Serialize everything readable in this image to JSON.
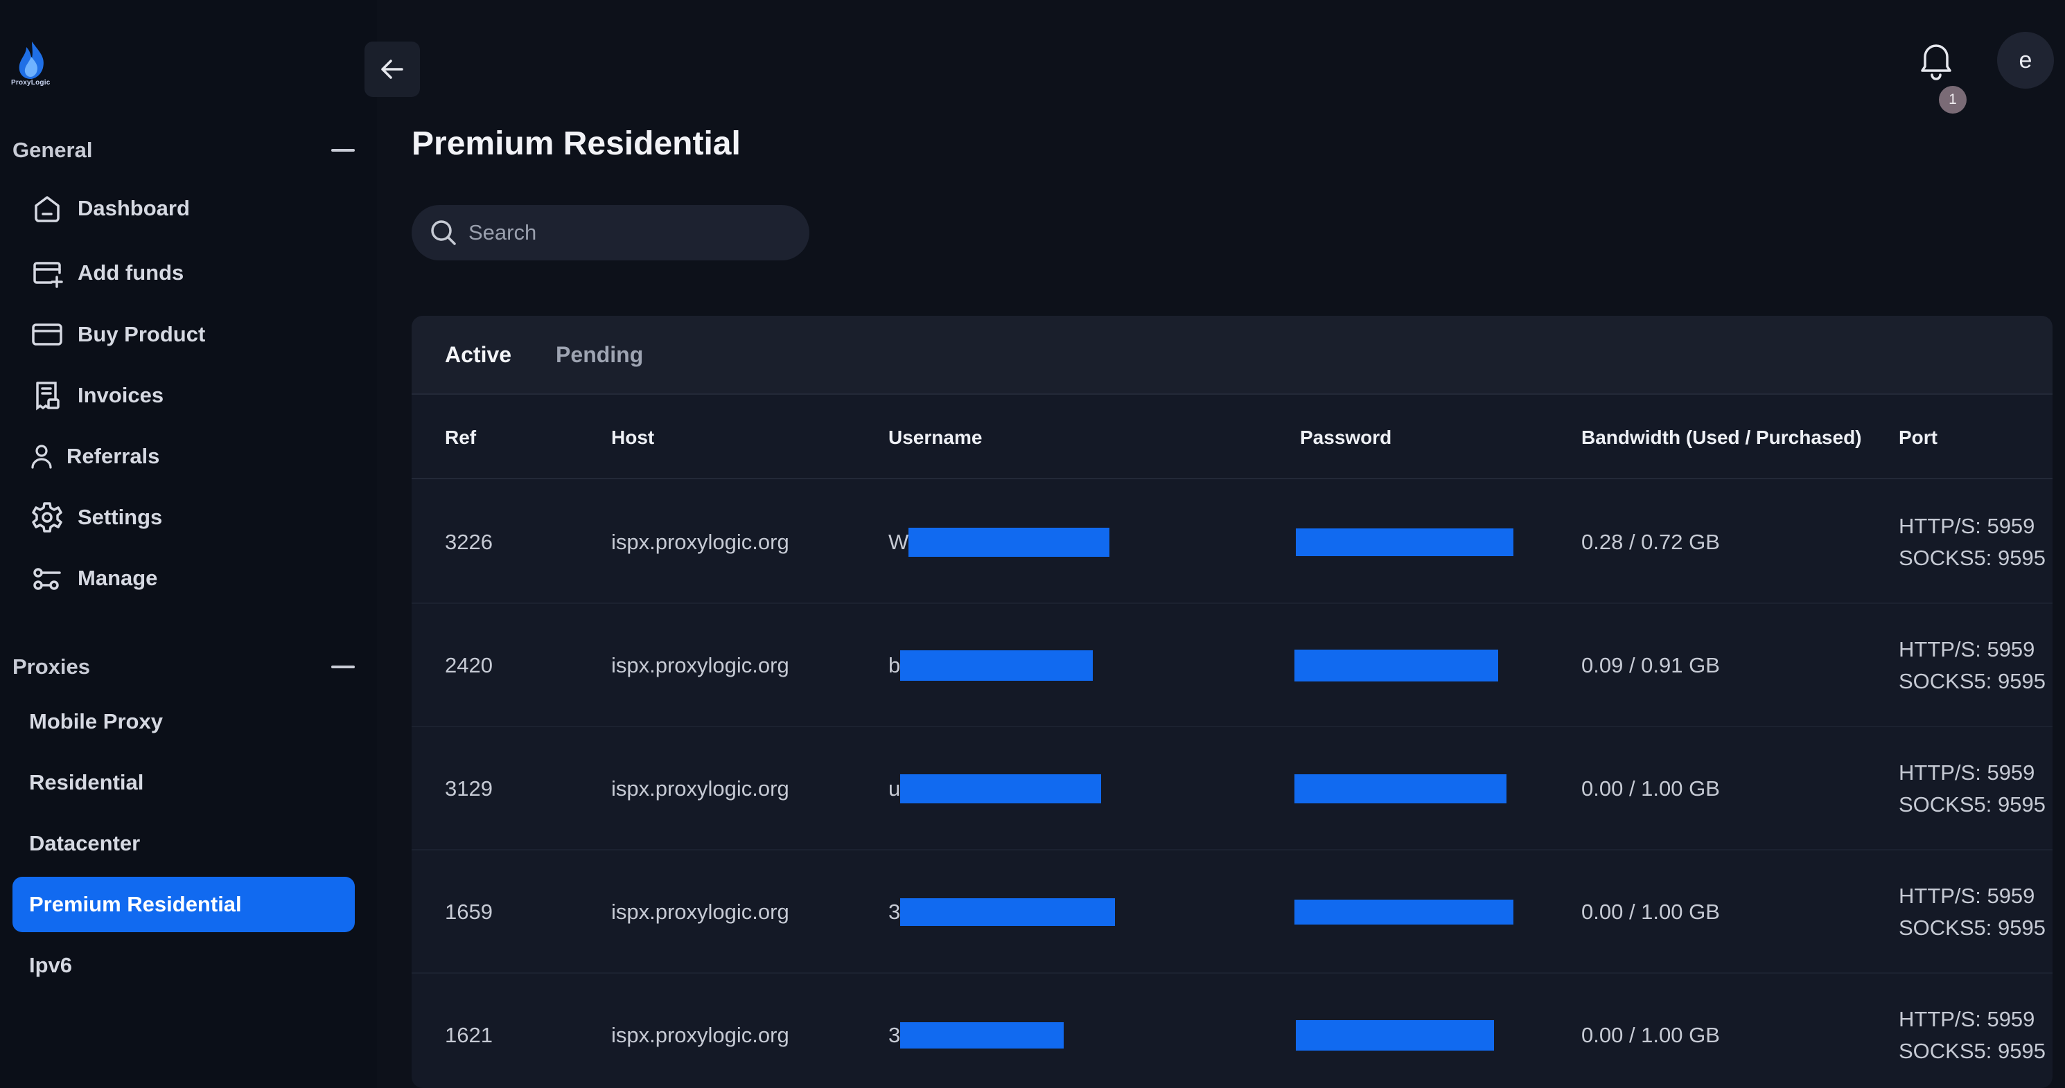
{
  "brand": {
    "logo_text": "ProxyLogic"
  },
  "sidebar": {
    "sections": [
      {
        "title": "General",
        "items": [
          {
            "label": "Dashboard",
            "icon": "home-icon"
          },
          {
            "label": "Add funds",
            "icon": "card-plus-icon"
          },
          {
            "label": "Buy Product",
            "icon": "credit-card-icon"
          },
          {
            "label": "Invoices",
            "icon": "receipt-icon"
          },
          {
            "label": "Referrals",
            "icon": "user-icon"
          },
          {
            "label": "Settings",
            "icon": "gear-icon"
          },
          {
            "label": "Manage",
            "icon": "sliders-icon"
          }
        ]
      },
      {
        "title": "Proxies",
        "items": [
          {
            "label": "Mobile Proxy"
          },
          {
            "label": "Residential"
          },
          {
            "label": "Datacenter"
          },
          {
            "label": "Premium Residential",
            "active": true
          },
          {
            "label": "Ipv6"
          }
        ]
      }
    ]
  },
  "topbar": {
    "notification_count": "1",
    "avatar_initial": "e"
  },
  "page": {
    "title": "Premium Residential"
  },
  "search": {
    "placeholder": "Search"
  },
  "tabs": [
    {
      "label": "Active",
      "active": true
    },
    {
      "label": "Pending"
    }
  ],
  "table": {
    "columns": [
      "Ref",
      "Host",
      "Username",
      "Password",
      "Bandwidth (Used / Purchased)",
      "Port"
    ],
    "rows": [
      {
        "ref": "3226",
        "host": "ispx.proxylogic.org",
        "username_prefix": "W",
        "bandwidth": "0.28 / 0.72 GB",
        "port_http": "HTTP/S: 5959",
        "port_socks": "SOCKS5: 9595"
      },
      {
        "ref": "2420",
        "host": "ispx.proxylogic.org",
        "username_prefix": "b",
        "bandwidth": "0.09 / 0.91 GB",
        "port_http": "HTTP/S: 5959",
        "port_socks": "SOCKS5: 9595"
      },
      {
        "ref": "3129",
        "host": "ispx.proxylogic.org",
        "username_prefix": "u",
        "bandwidth": "0.00 / 1.00 GB",
        "port_http": "HTTP/S: 5959",
        "port_socks": "SOCKS5: 9595"
      },
      {
        "ref": "1659",
        "host": "ispx.proxylogic.org",
        "username_prefix": "3",
        "bandwidth": "0.00 / 1.00 GB",
        "port_http": "HTTP/S: 5959",
        "port_socks": "SOCKS5: 9595"
      },
      {
        "ref": "1621",
        "host": "ispx.proxylogic.org",
        "username_prefix": "3",
        "bandwidth": "0.00 / 1.00 GB",
        "port_http": "HTTP/S: 5959",
        "port_socks": "SOCKS5: 9595"
      }
    ]
  },
  "colors": {
    "accent": "#116af0",
    "background": "#0d111a",
    "sidebar": "#0b0f18",
    "card": "#141926"
  }
}
